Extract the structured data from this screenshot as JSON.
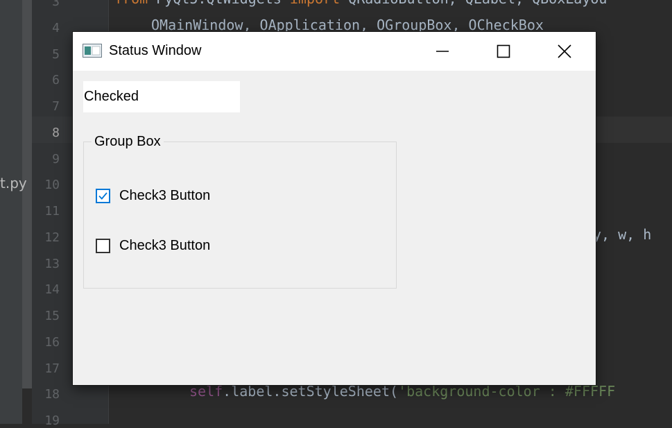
{
  "ide": {
    "line_numbers": [
      "3",
      "4",
      "5",
      "6",
      "7",
      "8",
      "9",
      "10",
      "11",
      "12",
      "13",
      "14",
      "15",
      "16",
      "17",
      "18",
      "19"
    ],
    "current_line": "8",
    "filename_fragment": "t.py",
    "code": {
      "line3_kw1": "from ",
      "line3_mod": "PyQt5.QtWidgets ",
      "line3_kw2": "import ",
      "line3_rest": "QRadioButton, QLabel, QBoxLayou",
      "line4": "OMainWindow, OApplication, OGroupBox, OCheckBox",
      "line12": "y, w, h",
      "line18_self": "self",
      "line18_mid": ".label.setStyleSheet(",
      "line18_str": "'background-color : #FFFFF"
    }
  },
  "window": {
    "title": "Status Window",
    "status_label": "Checked",
    "group_box_title": "Group Box",
    "checkboxes": [
      {
        "label": "Check3 Button",
        "checked": true
      },
      {
        "label": "Check3 Button",
        "checked": false
      }
    ],
    "accent_color": "#0078d7",
    "titlebar_icons": [
      "minimize-icon",
      "maximize-icon",
      "close-icon"
    ]
  }
}
